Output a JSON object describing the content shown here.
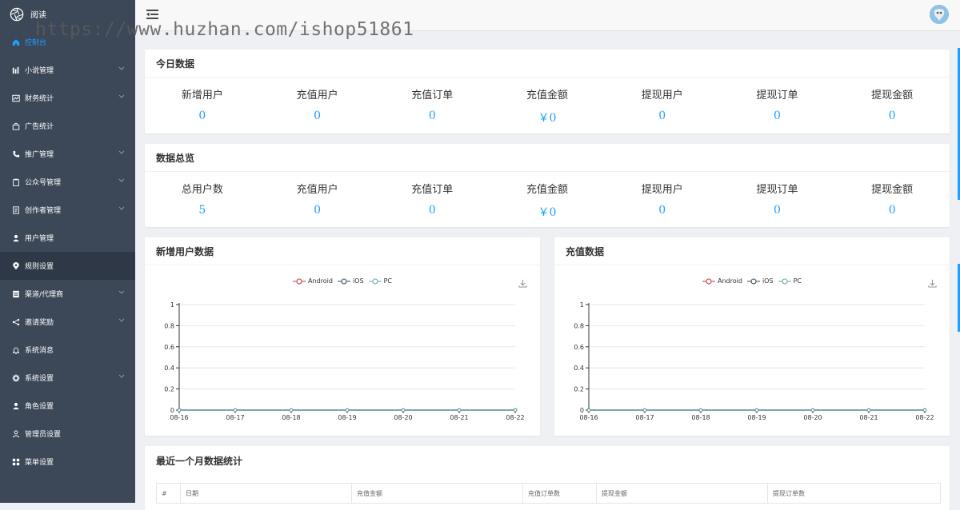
{
  "brand": {
    "name": "阅读"
  },
  "sidebar": {
    "items": [
      {
        "label": "控制台",
        "icon": "home-icon",
        "chevron": false,
        "active": true
      },
      {
        "label": "小说管理",
        "icon": "bar-chart-icon",
        "chevron": true
      },
      {
        "label": "财务统计",
        "icon": "chart-box-icon",
        "chevron": true
      },
      {
        "label": "广告统计",
        "icon": "bag-icon",
        "chevron": false
      },
      {
        "label": "推广管理",
        "icon": "phone-icon",
        "chevron": true
      },
      {
        "label": "公众号管理",
        "icon": "clipboard-icon",
        "chevron": true
      },
      {
        "label": "创作者管理",
        "icon": "document-icon",
        "chevron": true
      },
      {
        "label": "用户管理",
        "icon": "user-icon",
        "chevron": false
      },
      {
        "label": "规则设置",
        "icon": "location-icon",
        "chevron": false,
        "highlight": true
      },
      {
        "label": "渠道/代理商",
        "icon": "list-icon",
        "chevron": true
      },
      {
        "label": "邀请奖励",
        "icon": "share-icon",
        "chevron": true
      },
      {
        "label": "系统消息",
        "icon": "bell-icon",
        "chevron": false
      },
      {
        "label": "系统设置",
        "icon": "gear-icon",
        "chevron": true
      },
      {
        "label": "角色设置",
        "icon": "user-icon",
        "chevron": false
      },
      {
        "label": "管理员设置",
        "icon": "user-outline-icon",
        "chevron": false
      },
      {
        "label": "菜单设置",
        "icon": "grid-icon",
        "chevron": false
      }
    ]
  },
  "watermark": "https://www.huzhan.com/ishop51861",
  "today": {
    "title": "今日数据",
    "stats": [
      {
        "label": "新增用户",
        "value": "0"
      },
      {
        "label": "充值用户",
        "value": "0"
      },
      {
        "label": "充值订单",
        "value": "0"
      },
      {
        "label": "充值金额",
        "value": "￥0"
      },
      {
        "label": "提现用户",
        "value": "0"
      },
      {
        "label": "提现订单",
        "value": "0"
      },
      {
        "label": "提现金额",
        "value": "0"
      }
    ]
  },
  "overview": {
    "title": "数据总览",
    "stats": [
      {
        "label": "总用户数",
        "value": "5"
      },
      {
        "label": "充值用户",
        "value": "0"
      },
      {
        "label": "充值订单",
        "value": "0"
      },
      {
        "label": "充值金额",
        "value": "￥0"
      },
      {
        "label": "提现用户",
        "value": "0"
      },
      {
        "label": "提现订单",
        "value": "0"
      },
      {
        "label": "提现金额",
        "value": "0"
      }
    ]
  },
  "chart_left_title": "新增用户数据",
  "chart_right_title": "充值数据",
  "chart_data": [
    {
      "type": "line",
      "x": [
        "08-16",
        "08-17",
        "08-18",
        "08-19",
        "08-20",
        "08-21",
        "08-22"
      ],
      "series": [
        {
          "name": "Android",
          "color": "#c23531",
          "values": [
            0,
            0,
            0,
            0,
            0,
            0,
            0
          ]
        },
        {
          "name": "iOS",
          "color": "#2f4554",
          "values": [
            0,
            0,
            0,
            0,
            0,
            0,
            0
          ]
        },
        {
          "name": "PC",
          "color": "#61a0a8",
          "values": [
            0,
            0,
            0,
            0,
            0,
            0,
            0
          ]
        }
      ],
      "yticks": [
        "0",
        "0.2",
        "0.4",
        "0.6",
        "0.8",
        "1"
      ],
      "ylim": [
        0,
        1
      ],
      "grid": true,
      "legend": "top-center"
    },
    {
      "type": "line",
      "x": [
        "08-16",
        "08-17",
        "08-18",
        "08-19",
        "08-20",
        "08-21",
        "08-22"
      ],
      "series": [
        {
          "name": "Android",
          "color": "#c23531",
          "values": [
            0,
            0,
            0,
            0,
            0,
            0,
            0
          ]
        },
        {
          "name": "iOS",
          "color": "#2f4554",
          "values": [
            0,
            0,
            0,
            0,
            0,
            0,
            0
          ]
        },
        {
          "name": "PC",
          "color": "#61a0a8",
          "values": [
            0,
            0,
            0,
            0,
            0,
            0,
            0
          ]
        }
      ],
      "yticks": [
        "0",
        "0.2",
        "0.4",
        "0.6",
        "0.8",
        "1"
      ],
      "ylim": [
        0,
        1
      ],
      "grid": true,
      "legend": "top-center"
    }
  ],
  "monthly": {
    "title": "最近一个月数据统计",
    "columns": [
      "#",
      "日期",
      "充值金额",
      "充值订单数",
      "提现金额",
      "提现订单数"
    ]
  },
  "colors": {
    "accent": "#1e9fff",
    "sidebar": "#3c4758"
  }
}
